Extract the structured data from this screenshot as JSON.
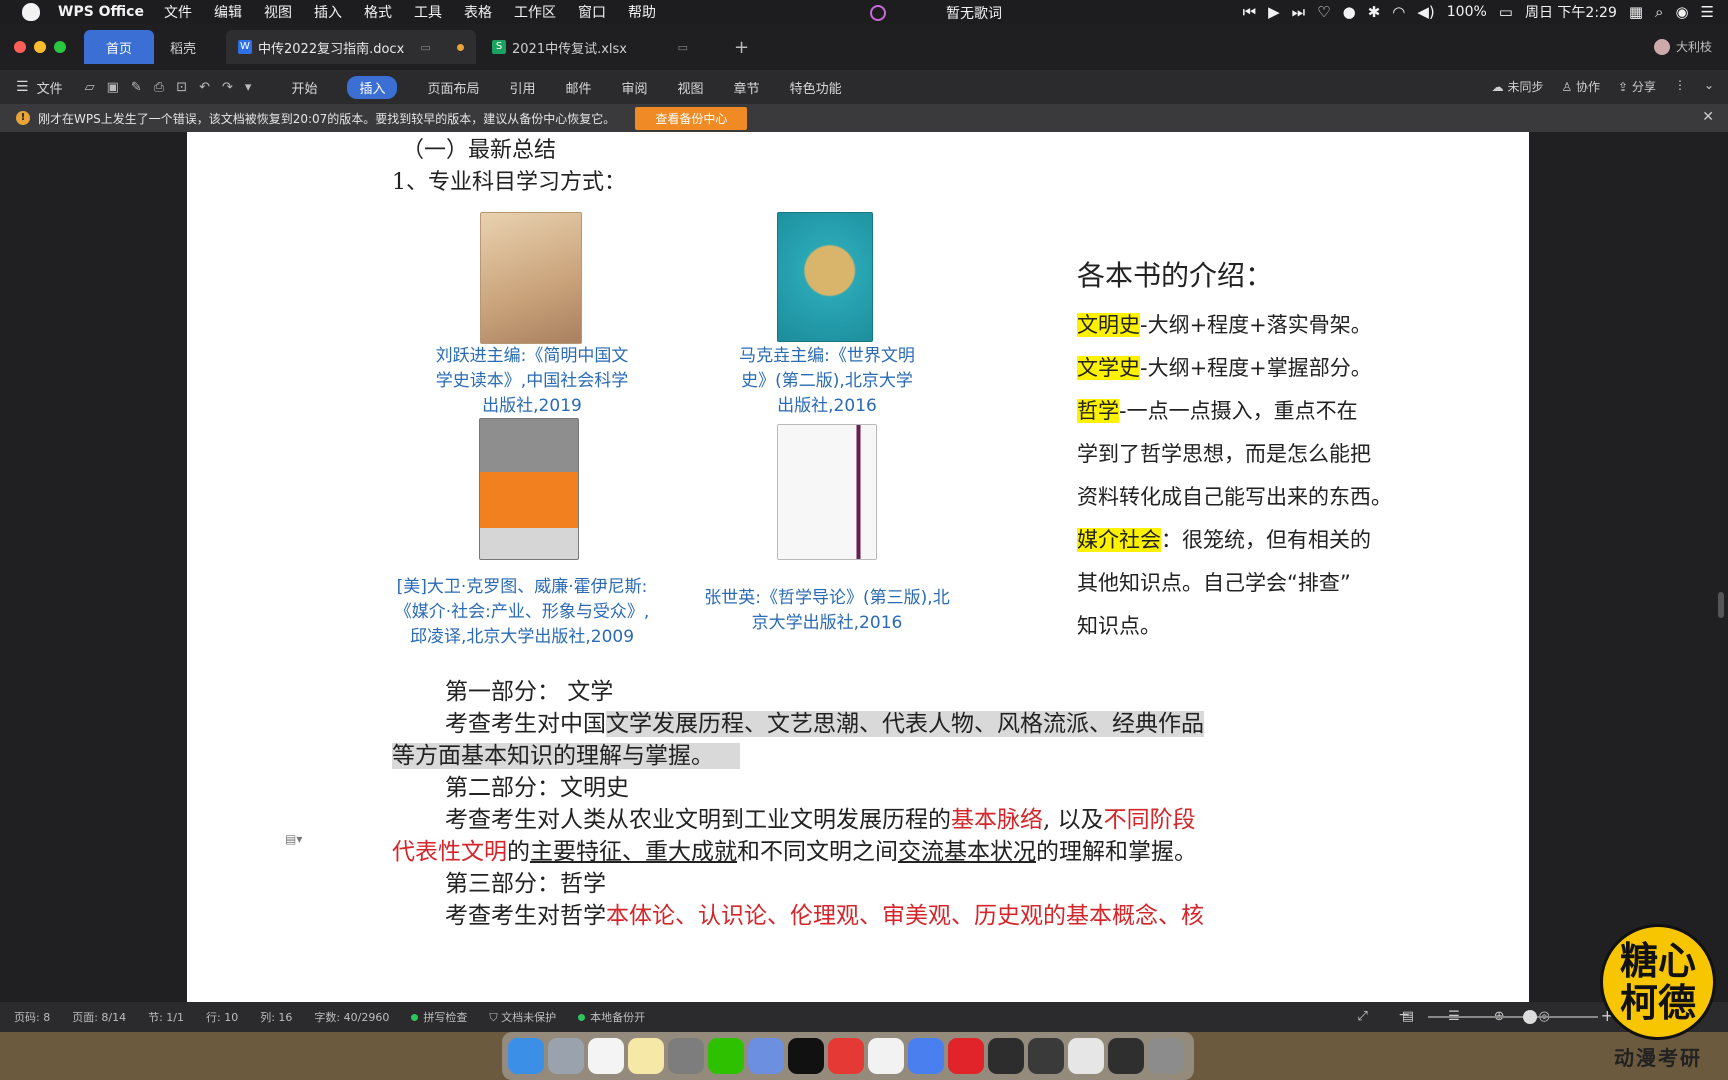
{
  "menubar": {
    "app_name": "WPS Office",
    "items": [
      "文件",
      "编辑",
      "视图",
      "插入",
      "格式",
      "工具",
      "表格",
      "工作区",
      "窗口",
      "帮助"
    ],
    "now_playing": "暂无歌词",
    "battery": "100%",
    "clock": "周日 下午2:29"
  },
  "tabs": {
    "home": "首页",
    "draft": "稻壳",
    "doc": "中传2022复习指南.docx",
    "xls": "2021中传复试.xlsx",
    "add": "+"
  },
  "user": {
    "name": "大利枝"
  },
  "ribbon": {
    "file": "文件",
    "tabs": [
      "开始",
      "插入",
      "页面布局",
      "引用",
      "邮件",
      "审阅",
      "视图",
      "章节",
      "特色功能"
    ],
    "active_tab": "插入",
    "sync": "未同步",
    "collab": "协作",
    "share": "分享"
  },
  "notice": {
    "text": "刚才在WPS上发生了一个错误，该文档被恢复到20:07的版本。要找到较早的版本，建议从备份中心恢复它。",
    "button": "查看备份中心"
  },
  "doc": {
    "heading": "（一）最新总结",
    "subheading": "1、专业科目学习方式：",
    "books": [
      {
        "caption": [
          "刘跃进主编:《简明中国文",
          "学史读本》,中国社会科学",
          "出版社,2019"
        ]
      },
      {
        "caption": [
          "马克垚主编:《世界文明",
          "史》(第二版),北京大学",
          "出版社,2016"
        ]
      },
      {
        "caption": [
          "[美]大卫·克罗图、威廉·霍伊尼斯:",
          "《媒介·社会:产业、形象与受众》,",
          "邱凌译,北京大学出版社,2009"
        ]
      },
      {
        "caption": [
          "张世英:《哲学导论》(第三版),北",
          "京大学出版社,2016"
        ]
      }
    ],
    "intro_title": "各本书的介绍：",
    "intro": {
      "l1_hl": "文明史",
      "l1": "-大纲+程度+落实骨架。",
      "l2_hl": "文学史",
      "l2": "-大纲+程度+掌握部分。",
      "l3_hl": "哲学",
      "l3": "-一点一点摄入，重点不在",
      "l4": "学到了哲学思想，而是怎么能把",
      "l5": "资料转化成自己能写出来的东西。",
      "l6_hl": "媒介社会",
      "l6": "：很笼统，但有相关的",
      "l7": "其他知识点。自己学会“排查”",
      "l8": "知识点。"
    },
    "p1_title": "第一部分：  文学",
    "p1_a": "考查考生对中国",
    "p1_b": "文学发展历程、文艺思潮、代表人物、风格流派、经典作品",
    "p1_c": "等方面基本知识的理解与掌握。",
    "p2_title": "第二部分：文明史",
    "p2_a": "考查考生对人类从农业文明到工业文明发展历程的",
    "p2_red1": "基本脉络",
    "p2_b": ", 以及",
    "p2_red2": "不同阶段",
    "p2_red3": "代表性文明",
    "p2_c": "的",
    "p2_u1": "主要特征、重大成就",
    "p2_d": "和不同文明之间",
    "p2_u2": "交流基本状况",
    "p2_e": "的理解和掌握。",
    "p3_title": "第三部分：哲学",
    "p3_a": "考查考生对哲学",
    "p3_red": "本体论、认识论、伦理观、审美观、历史观的基本概念、核"
  },
  "status": {
    "page_code": "页码: 8",
    "pages": "页面: 8/14",
    "section": "节: 1/1",
    "row": "行: 10",
    "col": "列: 16",
    "words": "字数: 40/2960",
    "spell": "拼写检查",
    "protect": "文档未保护",
    "backup": "本地备份开"
  },
  "watermark": {
    "line1": "糖心",
    "line2": "柯德",
    "sub": "动漫考研"
  }
}
